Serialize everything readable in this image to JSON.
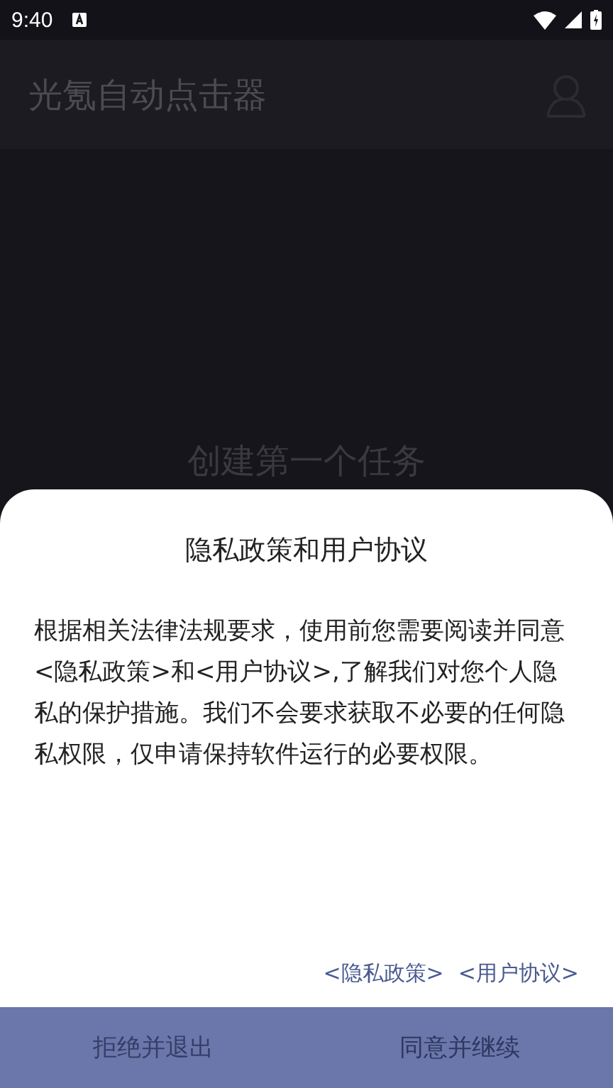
{
  "status_bar": {
    "time": "9:40"
  },
  "app_bar": {
    "title": "光氪自动点击器"
  },
  "empty_state": {
    "text": "创建第一个任务"
  },
  "dialog": {
    "title": "隐私政策和用户协议",
    "body": "根据相关法律法规要求，使用前您需要阅读并同意<隐私政策>和<用户协议>,了解我们对您个人隐私的保护措施。我们不会要求获取不必要的任何隐私权限，仅申请保持软件运行的必要权限。",
    "links": [
      "<隐私政策>",
      "<用户协议>"
    ],
    "buttons": [
      {
        "label": "拒绝并退出",
        "kind": "decline"
      },
      {
        "label": "同意并继续",
        "kind": "accept"
      }
    ]
  }
}
